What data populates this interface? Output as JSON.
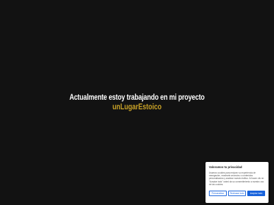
{
  "hero": {
    "line": "Actualmente estoy trabajando en mi proyecto",
    "brand": "unLugarEstoico"
  },
  "cookie_banner": {
    "title": "Valoramos tu privacidad",
    "text": "Usamos cookies para mejorar su experiencia de navegación, mostrarle anuncios o contenidos personalizados y analizar nuestro tráfico. Al hacer clic en \"Aceptar todo\" usted da su consentimiento a nuestro uso de las cookies.",
    "buttons": {
      "customize": "Personalizar",
      "reject": "Rechazar todo",
      "accept": "Aceptar todo"
    }
  },
  "colors": {
    "background": "#121212",
    "brand": "#c9a227",
    "accent": "#1863dc"
  }
}
